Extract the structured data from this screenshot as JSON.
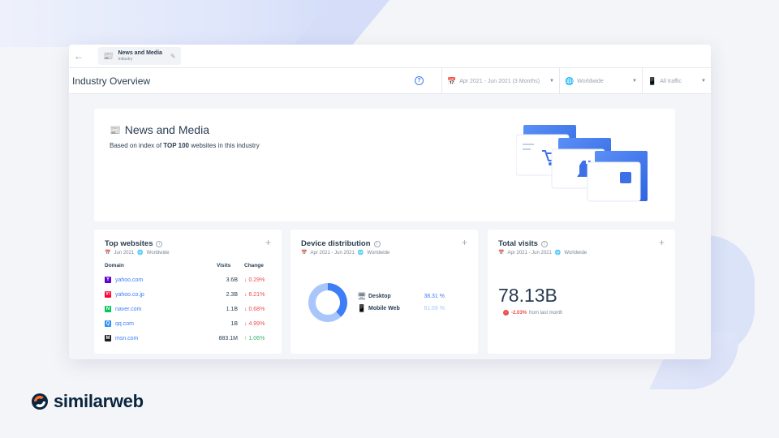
{
  "window": {
    "crumb": {
      "title": "News and Media",
      "subtitle": "Industry"
    },
    "header": {
      "title": "Industry Overview"
    },
    "filters": {
      "date": "Apr 2021 - Jun 2021 (3 Months)",
      "country": "Worldwide",
      "traffic": "All traffic"
    }
  },
  "hero": {
    "title": "News and Media",
    "subtitle_pre": "Based on index of ",
    "subtitle_bold": "TOP 100",
    "subtitle_post": " websites in this industry"
  },
  "top_websites": {
    "title": "Top websites",
    "date": "Jun 2021",
    "region": "Worldwide",
    "columns": {
      "domain": "Domain",
      "visits": "Visits",
      "change": "Change"
    },
    "rows": [
      {
        "domain": "yahoo.com",
        "visits": "3.6B",
        "change": "0.29%",
        "direction": "down",
        "icon": "yahoo-icon",
        "color": "#6001d2",
        "glyph": "Y"
      },
      {
        "domain": "yahoo.co.jp",
        "visits": "2.3B",
        "change": "6.21%",
        "direction": "down",
        "icon": "yahoo-jp-icon",
        "color": "#ff0033",
        "glyph": "Y!"
      },
      {
        "domain": "naver.com",
        "visits": "1.1B",
        "change": "0.68%",
        "direction": "down",
        "icon": "naver-icon",
        "color": "#03c75a",
        "glyph": "N"
      },
      {
        "domain": "qq.com",
        "visits": "1B",
        "change": "4.99%",
        "direction": "down",
        "icon": "qq-icon",
        "color": "#2b8ef5",
        "glyph": "Q"
      },
      {
        "domain": "msn.com",
        "visits": "883.1M",
        "change": "1.06%",
        "direction": "up",
        "icon": "msn-icon",
        "color": "#1b1b1b",
        "glyph": "M"
      }
    ]
  },
  "device_distribution": {
    "title": "Device distribution",
    "date": "Apr 2021 - Jun 2021",
    "region": "Worldwide",
    "items": [
      {
        "name": "Desktop",
        "value": "38.31 %",
        "share": 38.31,
        "color": "#3d7df5",
        "icon": "desktop-icon"
      },
      {
        "name": "Mobile Web",
        "value": "61.69 %",
        "share": 61.69,
        "color": "#a9c6fb",
        "icon": "mobile-icon"
      }
    ]
  },
  "total_visits": {
    "title": "Total visits",
    "date": "Apr 2021 - Jun 2021",
    "region": "Worldwide",
    "value": "78.13B",
    "delta": "-2.03%",
    "delta_label": "from last month"
  },
  "brand": {
    "name": "similarweb"
  },
  "colors": {
    "accent": "#3d7df5",
    "negative": "#ea4e4e",
    "positive": "#3bb273",
    "brand_orange": "#ff6b2c",
    "brand_navy": "#092540"
  }
}
